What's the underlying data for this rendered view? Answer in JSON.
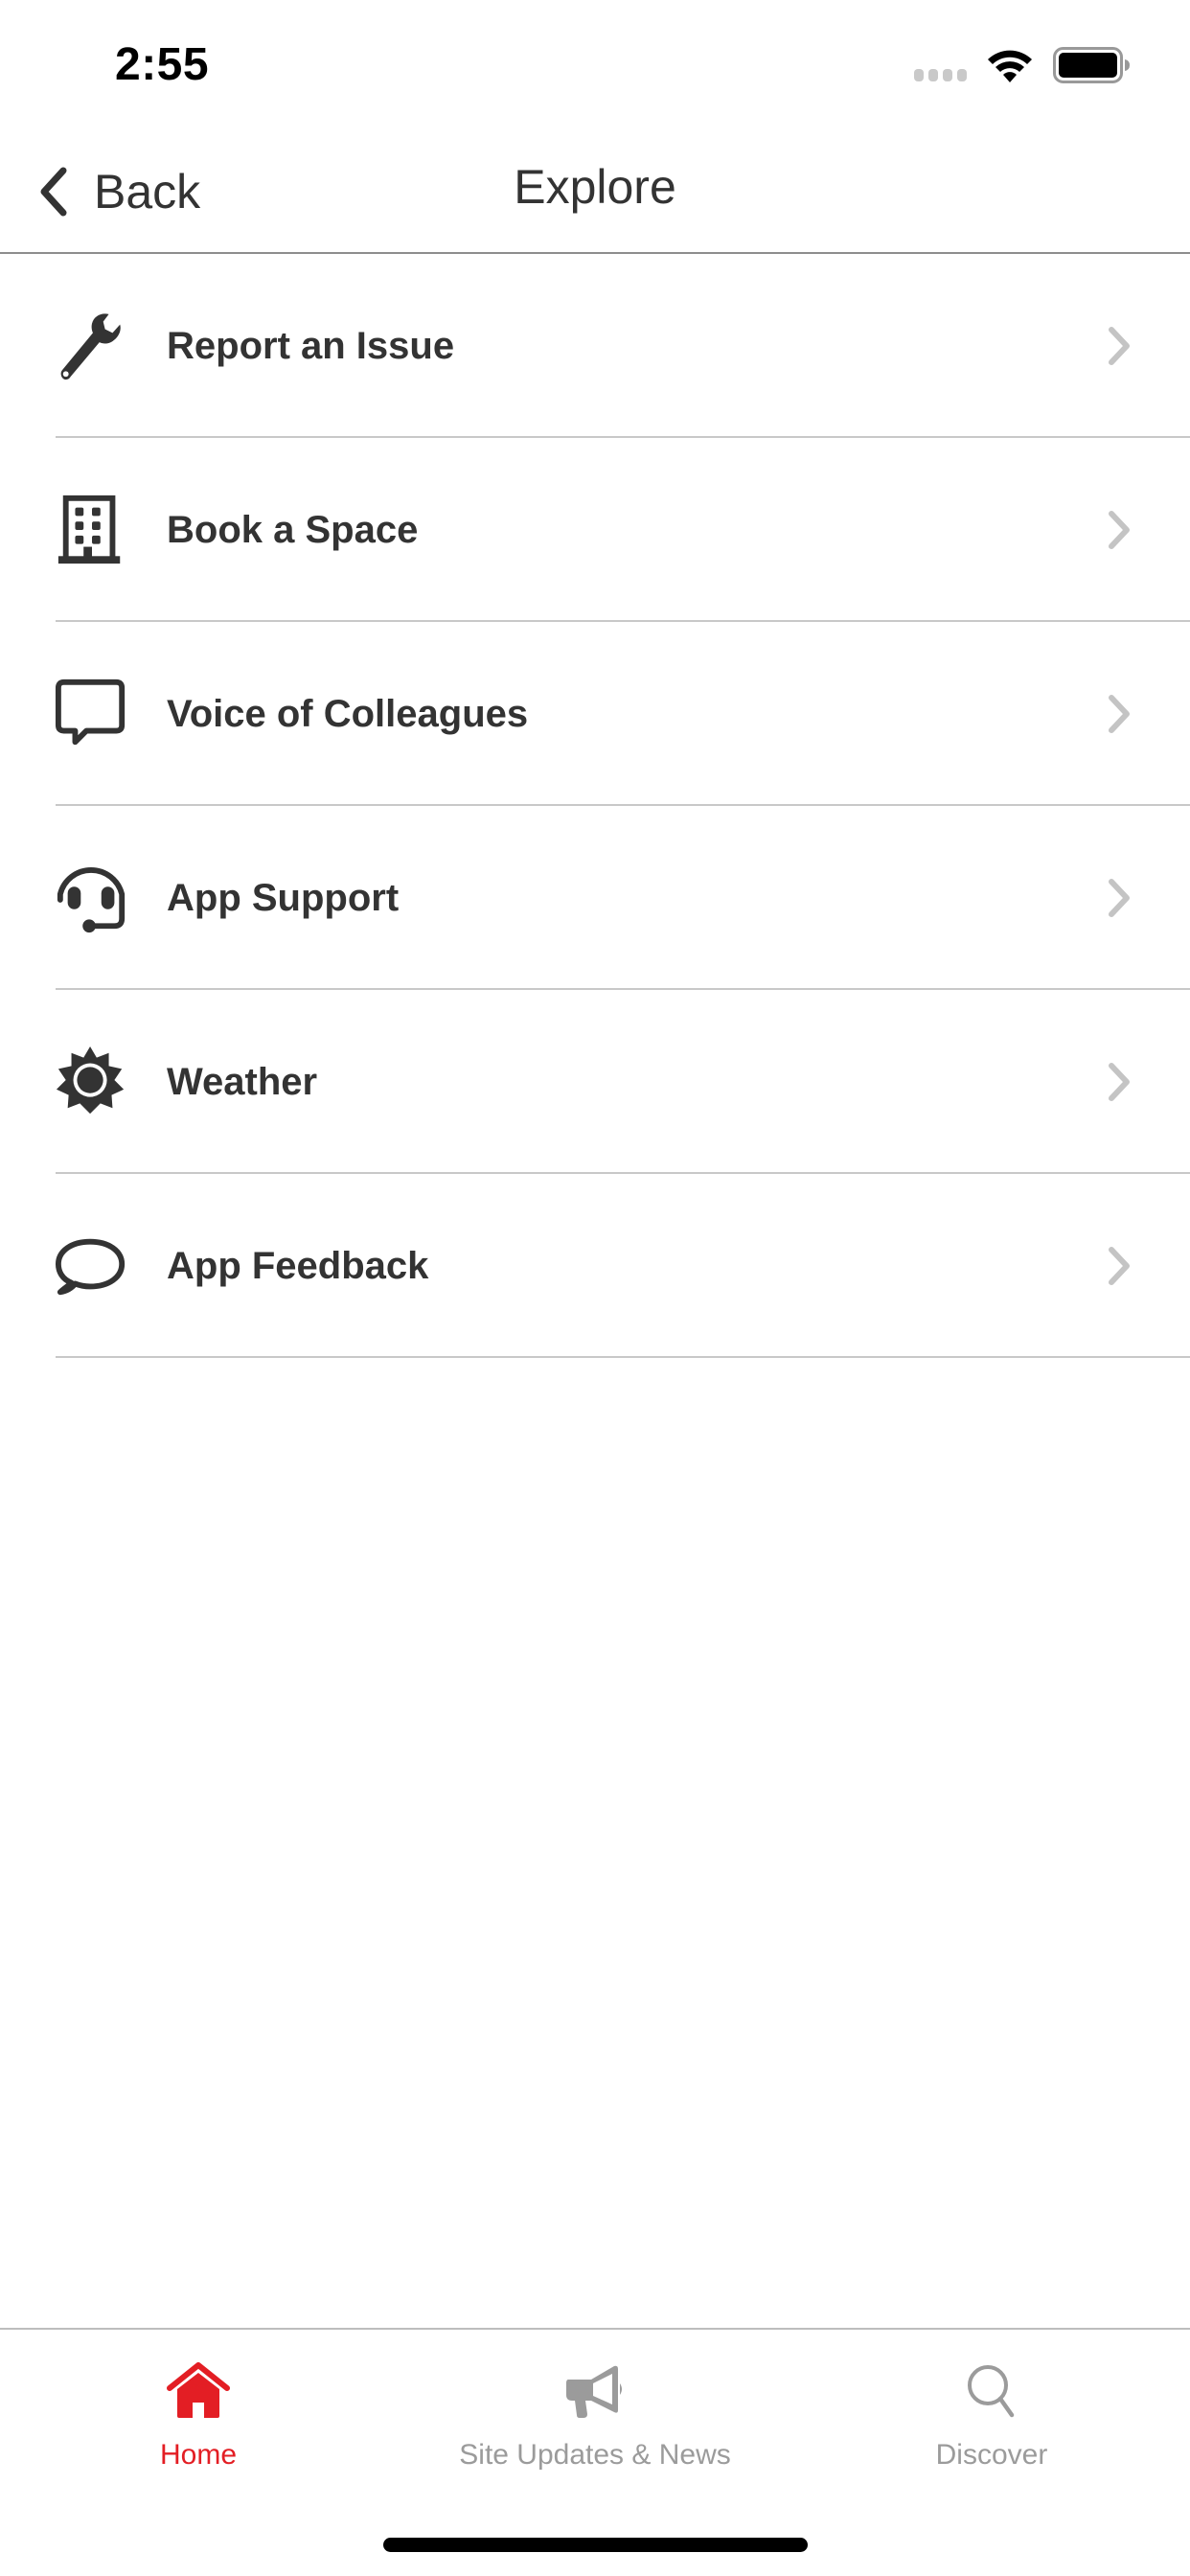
{
  "status_bar": {
    "time": "2:55",
    "signal_icon": "cellular-signal-icon",
    "wifi_icon": "wifi-icon",
    "battery_icon": "battery-icon"
  },
  "nav": {
    "back_label": "Back",
    "back_icon": "chevron-left-icon",
    "title": "Explore"
  },
  "list": {
    "items": [
      {
        "label": "Report an Issue",
        "icon": "wrench-icon"
      },
      {
        "label": "Book a Space",
        "icon": "building-icon"
      },
      {
        "label": "Voice of Colleagues",
        "icon": "chat-square-icon"
      },
      {
        "label": "App Support",
        "icon": "headset-icon"
      },
      {
        "label": "Weather",
        "icon": "sun-icon"
      },
      {
        "label": "App Feedback",
        "icon": "speech-bubble-icon"
      }
    ],
    "chevron_icon": "chevron-right-icon"
  },
  "tabbar": {
    "active_color": "#e31e24",
    "inactive_color": "#9b9b9b",
    "tabs": [
      {
        "label": "Home",
        "icon": "home-icon",
        "active": true
      },
      {
        "label": "Site Updates & News",
        "icon": "megaphone-icon",
        "active": false
      },
      {
        "label": "Discover",
        "icon": "search-icon",
        "active": false
      }
    ]
  }
}
